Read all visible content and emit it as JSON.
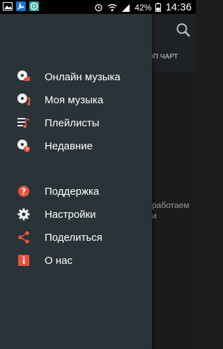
{
  "status_bar": {
    "battery": "42%",
    "time": "14:36"
  },
  "background": {
    "tab_label": "ОП ЧАРТ",
    "text_lines": [
      "работаем",
      "и"
    ]
  },
  "menu": {
    "section1": [
      {
        "label": "Онлайн музыка",
        "icon": "online-music-icon"
      },
      {
        "label": "Моя музыка",
        "icon": "my-music-icon"
      },
      {
        "label": "Плейлисты",
        "icon": "playlist-icon"
      },
      {
        "label": "Недавние",
        "icon": "recent-icon"
      }
    ],
    "section2": [
      {
        "label": "Поддержка",
        "icon": "support-icon"
      },
      {
        "label": "Настройки",
        "icon": "settings-icon"
      },
      {
        "label": "Поделиться",
        "icon": "share-icon"
      },
      {
        "label": "О нас",
        "icon": "about-icon"
      }
    ]
  },
  "colors": {
    "accent": "#e8533a",
    "drawer_bg": "#2a3338"
  }
}
